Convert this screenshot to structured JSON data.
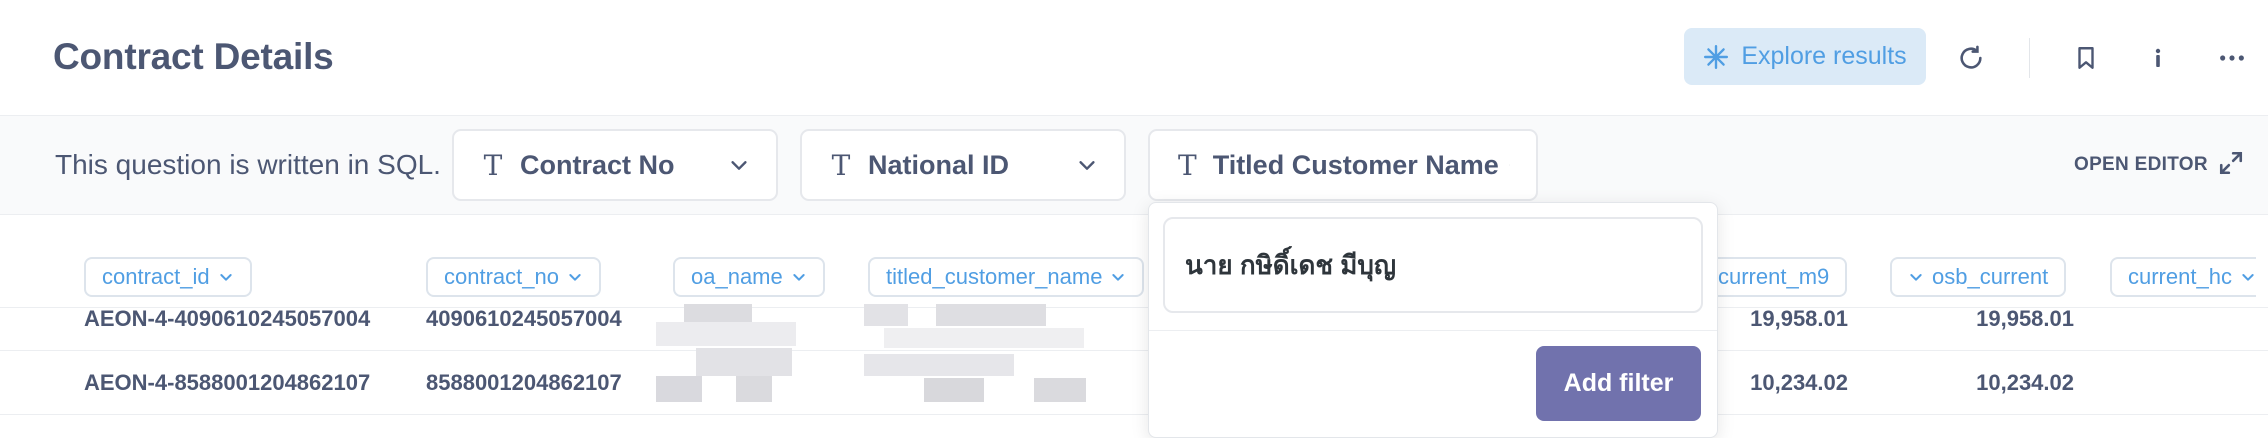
{
  "header": {
    "title": "Contract Details",
    "explore_label": "Explore results",
    "icons": [
      "explore-sparkle-icon",
      "refresh-icon",
      "bookmark-icon",
      "info-icon",
      "more-icon"
    ]
  },
  "filterbar": {
    "sql_note": "This question is written in SQL.",
    "filters": [
      {
        "label": "Contract No",
        "icon": "text-type-icon"
      },
      {
        "label": "National ID",
        "icon": "text-type-icon"
      },
      {
        "label": "Titled Customer Name",
        "icon": "text-type-icon"
      }
    ],
    "open_editor": "OPEN EDITOR"
  },
  "table": {
    "columns": [
      "contract_id",
      "contract_no",
      "oa_name",
      "titled_customer_name",
      "current_m9",
      "osb_current",
      "current_hc"
    ],
    "rows": [
      {
        "contract_id": "AEON-4-4090610245057004",
        "contract_no": "4090610245057004",
        "current_m9": "19,958.01",
        "osb_current": "19,958.01"
      },
      {
        "contract_id": "AEON-4-8588001204862107",
        "contract_no": "8588001204862107",
        "current_m9": "10,234.02",
        "osb_current": "10,234.02"
      }
    ]
  },
  "popover": {
    "input_value": "นาย กษิดิ์เดช มีบุญ",
    "add_filter_label": "Add filter"
  },
  "colors": {
    "brand_blue": "#509ee3",
    "accent_purple": "#7172ad",
    "text": "#4c5773"
  }
}
